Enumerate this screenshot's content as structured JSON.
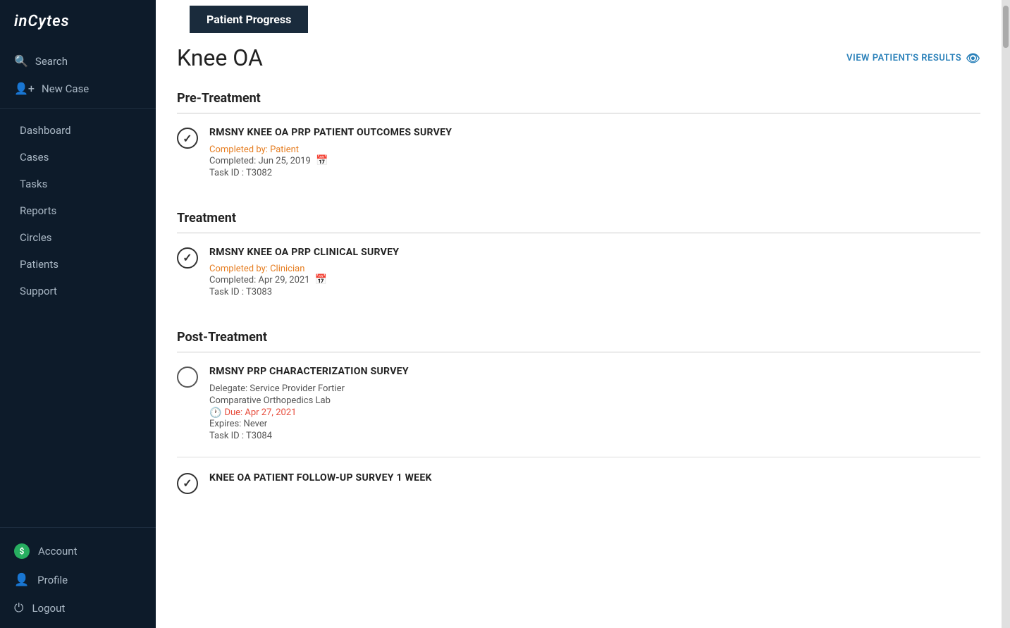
{
  "app": {
    "logo": "inCytes"
  },
  "sidebar": {
    "actions": [
      {
        "id": "search",
        "label": "Search",
        "icon": "🔍"
      },
      {
        "id": "new-case",
        "label": "New Case",
        "icon": "➕"
      }
    ],
    "nav_items": [
      {
        "id": "dashboard",
        "label": "Dashboard"
      },
      {
        "id": "cases",
        "label": "Cases"
      },
      {
        "id": "tasks",
        "label": "Tasks"
      },
      {
        "id": "reports",
        "label": "Reports"
      },
      {
        "id": "circles",
        "label": "Circles"
      },
      {
        "id": "patients",
        "label": "Patients"
      },
      {
        "id": "support",
        "label": "Support"
      }
    ],
    "bottom_items": [
      {
        "id": "account",
        "label": "Account",
        "icon": "$"
      },
      {
        "id": "profile",
        "label": "Profile",
        "icon": "👤"
      },
      {
        "id": "logout",
        "label": "Logout",
        "icon": "⏻"
      }
    ]
  },
  "main": {
    "tab_label": "Patient Progress",
    "page_title": "Knee OA",
    "view_results_label": "VIEW PATIENT'S RESULTS",
    "sections": [
      {
        "id": "pre-treatment",
        "title": "Pre-Treatment",
        "tasks": [
          {
            "id": "task-t3082",
            "name": "RMSNY KNEE OA PRP PATIENT OUTCOMES SURVEY",
            "completed": true,
            "completed_by_label": "Completed by: Patient",
            "completed_date_label": "Completed: Jun 25, 2019",
            "task_id_label": "Task ID : T3082",
            "has_cal": true,
            "delegate": null,
            "due": null,
            "expires": null
          }
        ]
      },
      {
        "id": "treatment",
        "title": "Treatment",
        "tasks": [
          {
            "id": "task-t3083",
            "name": "RMSNY KNEE OA PRP CLINICAL SURVEY",
            "completed": true,
            "completed_by_label": "Completed by: Clinician",
            "completed_date_label": "Completed: Apr 29, 2021",
            "task_id_label": "Task ID : T3083",
            "has_cal": true,
            "delegate": null,
            "due": null,
            "expires": null
          }
        ]
      },
      {
        "id": "post-treatment",
        "title": "Post-Treatment",
        "tasks": [
          {
            "id": "task-t3084",
            "name": "RMSNY PRP CHARACTERIZATION SURVEY",
            "completed": false,
            "completed_by_label": null,
            "completed_date_label": null,
            "task_id_label": "Task ID : T3084",
            "has_cal": false,
            "delegate": "Delegate: Service Provider Fortier",
            "delegate2": "Comparative Orthopedics Lab",
            "due": "Due: Apr 27, 2021",
            "expires": "Expires: Never"
          },
          {
            "id": "task-t3085",
            "name": "KNEE OA PATIENT FOLLOW-UP SURVEY 1 WEEK",
            "completed": true,
            "completed_by_label": null,
            "completed_date_label": null,
            "task_id_label": null,
            "has_cal": false,
            "delegate": null,
            "due": null,
            "expires": null
          }
        ]
      }
    ]
  }
}
